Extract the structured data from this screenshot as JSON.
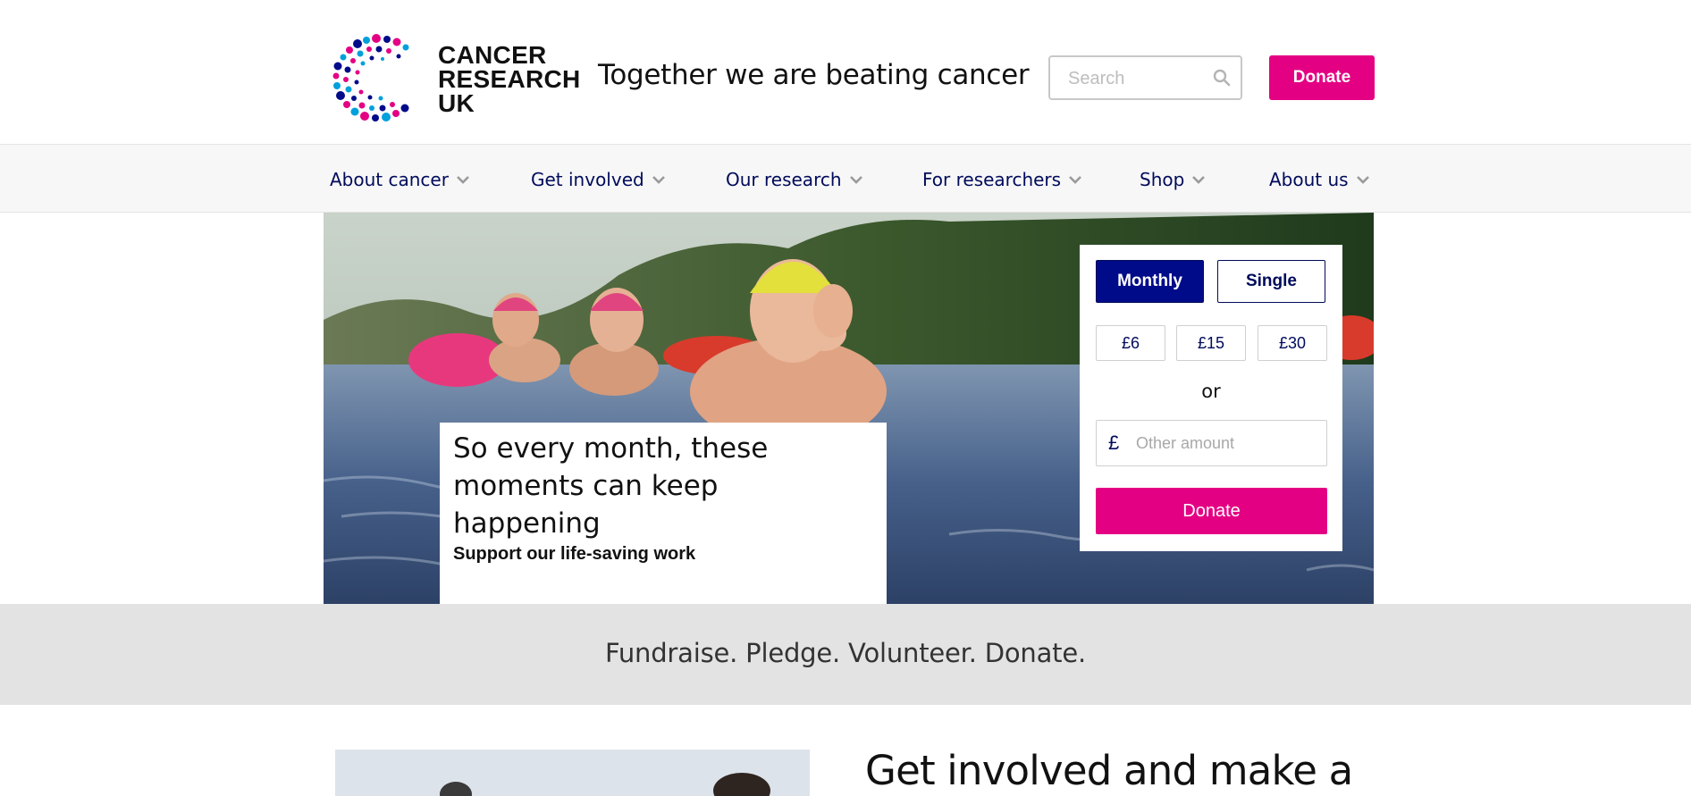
{
  "header": {
    "logo_lines": [
      "CANCER",
      "RESEARCH",
      "UK"
    ],
    "tagline": "Together we are beating cancer",
    "search": {
      "placeholder": "Search",
      "value": ""
    },
    "donate_label": "Donate"
  },
  "nav": {
    "items": [
      {
        "label": "About cancer"
      },
      {
        "label": "Get involved"
      },
      {
        "label": "Our research"
      },
      {
        "label": "For researchers"
      },
      {
        "label": "Shop"
      },
      {
        "label": "About us"
      }
    ]
  },
  "hero": {
    "title": "So every month, these moments can keep happening",
    "subtitle": "Support our life-saving work",
    "donation": {
      "frequency": {
        "monthly": "Monthly",
        "single": "Single",
        "selected": "Monthly"
      },
      "amounts": [
        "£6",
        "£15",
        "£30"
      ],
      "or_text": "or",
      "currency_symbol": "£",
      "other_amount_placeholder": "Other amount",
      "donate_label": "Donate"
    }
  },
  "band": {
    "text": "Fundraise. Pledge. Volunteer. Donate."
  },
  "lower": {
    "heading": "Get involved and make a"
  },
  "colors": {
    "brand_pink": "#e40083",
    "navy": "#000b5b",
    "monthly_blue": "#000b8a",
    "band_grey": "#e3e3e3",
    "nav_bg": "#f7f7f7"
  },
  "icons": {
    "search": "search-icon",
    "chevron": "chevron-down-icon",
    "logo": "cancer-research-uk-logo"
  }
}
